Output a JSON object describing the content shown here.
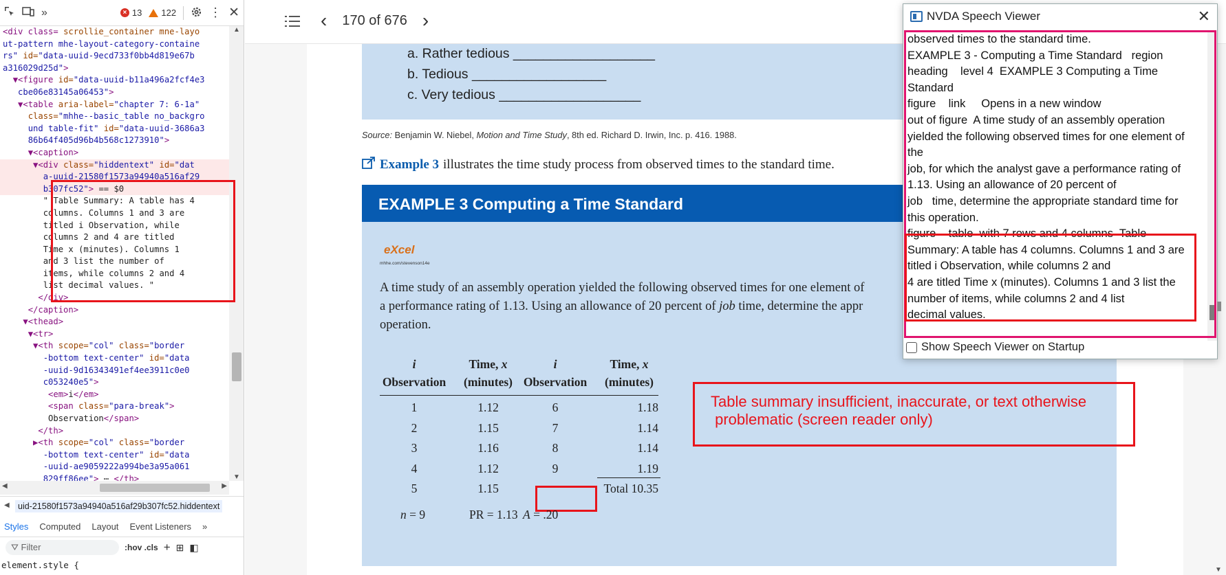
{
  "devtools": {
    "error_count": "13",
    "warning_count": "122",
    "code_lines": [
      {
        "html": "<span class=\"tag\">&lt;div class=</span> <span class=\"attr\">scrollie_container</span> <span class=\"attr\">mne-layo</span>"
      },
      {
        "html": "<span class=\"val\">ut-pattern mhe-layout-category-containe</span>"
      },
      {
        "html": "<span class=\"val\">rs\"</span> <span class=\"attr\">id=</span><span class=\"val\">\"data-uuid-9ecd733f0bb4d819e67b</span>"
      },
      {
        "html": "<span class=\"val\">a316029d25d\"</span><span class=\"tag\">&gt;</span>"
      },
      {
        "html": "  <span class=\"tag\">▼&lt;figure</span> <span class=\"attr\">id=</span><span class=\"val\">\"data-uuid-b11a496a2fcf4e3</span>"
      },
      {
        "html": "   <span class=\"val\">cbe06e83145a06453\"</span><span class=\"tag\">&gt;</span>"
      },
      {
        "html": "   <span class=\"tag\">▼&lt;table</span> <span class=\"attr\">aria-label=</span><span class=\"val\">\"chapter 7: 6-1a\"</span>"
      },
      {
        "html": "     <span class=\"attr\">class=</span><span class=\"val\">\"mhhe--basic_table no_backgro</span>"
      },
      {
        "html": "     <span class=\"val\">und table-fit\"</span> <span class=\"attr\">id=</span><span class=\"val\">\"data-uuid-3686a3</span>"
      },
      {
        "html": "     <span class=\"val\">86b64f405d96b4b568c1273910\"</span><span class=\"tag\">&gt;</span>"
      },
      {
        "html": "     <span class=\"tag\">▼&lt;caption&gt;</span>"
      },
      {
        "html": "      <span class=\"tag\">▼&lt;div</span> <span class=\"attr\">class=</span><span class=\"val\">\"hiddentext\"</span> <span class=\"attr\">id=</span><span class=\"val\">\"dat</span>",
        "cls": "hl"
      },
      {
        "html": "        <span class=\"val\">a-uuid-21580f1573a94940a516af29</span>",
        "cls": "hl"
      },
      {
        "html": "        <span class=\"val\">b307fc52\"</span><span class=\"tag\">&gt;</span> <span class=\"txt\">== $0</span>",
        "cls": "hl"
      },
      {
        "html": "        <span class=\"txt\">\" Table Summary: A table has 4</span>"
      },
      {
        "html": "        <span class=\"txt\">columns. Columns 1 and 3 are</span>"
      },
      {
        "html": "        <span class=\"txt\">titled i Observation, while</span>"
      },
      {
        "html": "        <span class=\"txt\">columns 2 and 4 are titled</span>"
      },
      {
        "html": "        <span class=\"txt\">Time x (minutes). Columns 1</span>"
      },
      {
        "html": "        <span class=\"txt\">and 3 list the number of</span>"
      },
      {
        "html": "        <span class=\"txt\">items, while columns 2 and 4</span>"
      },
      {
        "html": "        <span class=\"txt\">list decimal values. \"</span>"
      },
      {
        "html": "       <span class=\"tag\">&lt;/div&gt;</span>"
      },
      {
        "html": "     <span class=\"tag\">&lt;/caption&gt;</span>"
      },
      {
        "html": "    <span class=\"tag\">▼&lt;thead&gt;</span>"
      },
      {
        "html": "     <span class=\"tag\">▼&lt;tr&gt;</span>"
      },
      {
        "html": "      <span class=\"tag\">▼&lt;th</span> <span class=\"attr\">scope=</span><span class=\"val\">\"col\"</span> <span class=\"attr\">class=</span><span class=\"val\">\"border</span>"
      },
      {
        "html": "        <span class=\"val\">-bottom text-center\"</span> <span class=\"attr\">id=</span><span class=\"val\">\"data</span>"
      },
      {
        "html": "        <span class=\"val\">-uuid-9d16343491ef4ee3911c0e0</span>"
      },
      {
        "html": "        <span class=\"val\">c053240e5\"</span><span class=\"tag\">&gt;</span>"
      },
      {
        "html": "         <span class=\"tag\">&lt;em&gt;</span><span class=\"txt\">i</span><span class=\"tag\">&lt;/em&gt;</span>"
      },
      {
        "html": "         <span class=\"tag\">&lt;span</span> <span class=\"attr\">class=</span><span class=\"val\">\"para-break\"</span><span class=\"tag\">&gt;</span>"
      },
      {
        "html": "         <span class=\"txt\">Observation</span><span class=\"tag\">&lt;/span&gt;</span>"
      },
      {
        "html": "       <span class=\"tag\">&lt;/th&gt;</span>"
      },
      {
        "html": "      <span class=\"tag\">▶&lt;th</span> <span class=\"attr\">scope=</span><span class=\"val\">\"col\"</span> <span class=\"attr\">class=</span><span class=\"val\">\"border</span>"
      },
      {
        "html": "        <span class=\"val\">-bottom text-center\"</span> <span class=\"attr\">id=</span><span class=\"val\">\"data</span>"
      },
      {
        "html": "        <span class=\"val\">-uuid-ae9059222a994be3a95a061</span>"
      },
      {
        "html": "        <span class=\"val\">829ff86ee\"</span><span class=\"tag\">&gt;</span> <span class=\"txt\">⋯</span> <span class=\"tag\">&lt;/th&gt;</span>"
      }
    ],
    "breadcrumb": "uid-21580f1573a94940a516af29b307fc52.hiddentext",
    "tabs": [
      "Styles",
      "Computed",
      "Layout",
      "Event Listeners"
    ],
    "filter_placeholder": "Filter",
    "filter_toggles": ":hov  .cls",
    "element_style": "element.style {",
    "element_style_close": "}"
  },
  "reader": {
    "page_indicator": "170 of 676",
    "question_items": [
      "a. Rather tedious ___________________",
      "b. Tedious __________________",
      "c. Very tedious ___________________"
    ],
    "source_label": "Source:",
    "source_text": " Benjamin W. Niebel, ",
    "source_italic": "Motion and Time Study",
    "source_tail": ", 8th ed. Richard D. Irwin, Inc. p. 416. 1988.",
    "example_link": "Example 3",
    "example_ref_tail": "illustrates the time study process from observed times to the standard time.",
    "example_heading": "EXAMPLE 3 Computing a Time Standard",
    "excel_logo_text": "eXcel",
    "excel_logo_sub": "mhhe.com/stevenson14e",
    "example_line1": "A time study of an assembly operation yielded the following observed times for one element of",
    "example_line2_a": "a performance rating of 1.13. Using an allowance of 20 percent of ",
    "example_line2_job": "job",
    "example_line2_b": " time, determine the appr",
    "example_line3": "operation.",
    "table": {
      "headers_top": [
        "i",
        "Time, x",
        "i",
        "Time, x"
      ],
      "headers_bottom": [
        "Observation",
        "(minutes)",
        "Observation",
        "(minutes)"
      ],
      "rows": [
        [
          "1",
          "1.12",
          "6",
          "1.18"
        ],
        [
          "2",
          "1.15",
          "7",
          "1.14"
        ],
        [
          "3",
          "1.16",
          "8",
          "1.14"
        ],
        [
          "4",
          "1.12",
          "9",
          "1.19"
        ],
        [
          "5",
          "1.15",
          "",
          "Total 10.35"
        ]
      ],
      "footer": [
        "n = 9",
        "PR = 1.13",
        "A = .20"
      ]
    }
  },
  "nvda": {
    "title": "NVDA Speech Viewer",
    "lines": [
      "observed times to the standard time.",
      "EXAMPLE 3 - Computing a Time Standard   region",
      "heading    level 4  EXAMPLE 3 Computing a Time",
      "Standard",
      "figure    link     Opens in a new window",
      "out of figure  A time study of an assembly operation",
      "yielded the following observed times for one element of",
      "the",
      "job, for which the analyst gave a performance rating of",
      "1.13. Using an allowance of 20 percent of",
      "job   time, determine the appropriate standard time for",
      "this operation.",
      "figure    table  with 7 rows and 4 columns  Table",
      "Summary: A table has 4 columns. Columns 1 and 3 are",
      "titled i Observation, while columns 2 and",
      "4 are titled Time x (minutes). Columns 1 and 3 list the",
      "number of items, while columns 2 and 4 list",
      "decimal values."
    ],
    "startup_label": "Show Speech Viewer on Startup"
  },
  "annotation": {
    "text_line1": "Table summary insufficient, inaccurate, or text otherwise",
    "text_line2": " problematic (screen reader only)",
    "color": "#e8141b"
  }
}
